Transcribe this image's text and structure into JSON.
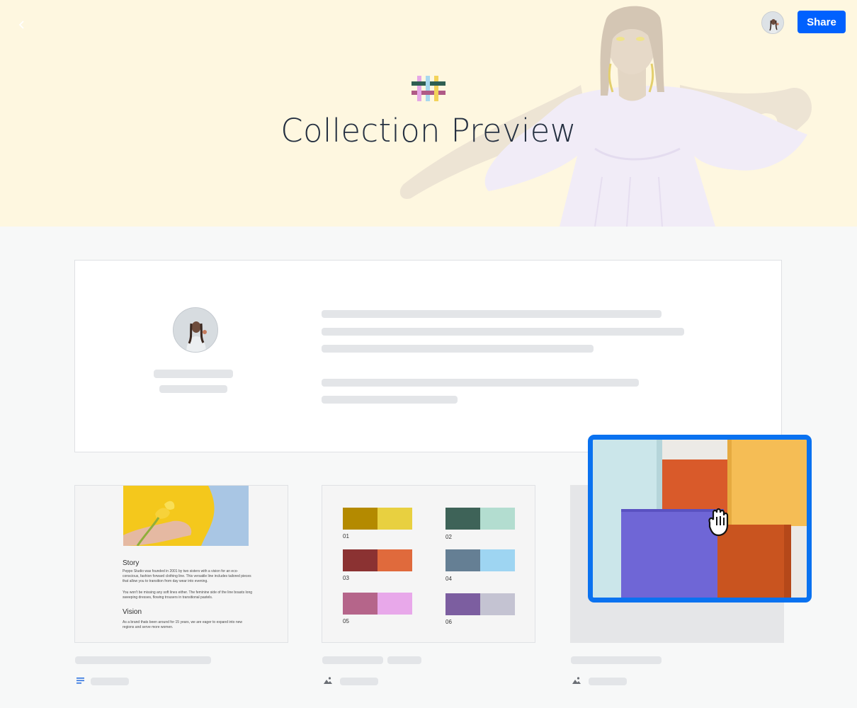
{
  "header": {
    "title": "Collection Preview",
    "share_label": "Share",
    "back_icon": "chevron-left-icon",
    "logo_icon": "woven-logo-icon"
  },
  "profile": {
    "avatar_icon": "profile-avatar"
  },
  "tiles": [
    {
      "kind": "document",
      "story_heading": "Story",
      "story_text_1": "Peppo Studio was founded in 2001 by two sisters with a vision for an eco-conscious, fashion forward clothing line. This versatile line includes tailored pieces that allow you to transition from day wear into evening.",
      "story_text_2": "You won't be missing any soft lines either. The feminine side of the line boasts long sweeping dresses, flowing trousers in transitional pastels.",
      "vision_heading": "Vision",
      "vision_text": "As a brand thats been around for 15 years, we are eager to expand into new regions and serve more women.",
      "meta_icon": "text-lines-icon"
    },
    {
      "kind": "palette",
      "swatches": [
        {
          "label": "01",
          "colors": [
            "#b48a00",
            "#e8d040"
          ]
        },
        {
          "label": "02",
          "colors": [
            "#3e6358",
            "#b3ddd0"
          ]
        },
        {
          "label": "03",
          "colors": [
            "#8b3232",
            "#e06a3c"
          ]
        },
        {
          "label": "04",
          "colors": [
            "#657f94",
            "#9ed5f2"
          ]
        },
        {
          "label": "05",
          "colors": [
            "#b5658a",
            "#e8a8ea"
          ]
        },
        {
          "label": "06",
          "colors": [
            "#7c5ea0",
            "#c4c3d2"
          ]
        }
      ],
      "meta_icon": "image-icon"
    },
    {
      "kind": "image",
      "meta_icon": "image-icon"
    }
  ],
  "drag": {
    "preview": "fabric-swatches-photo",
    "cursor_icon": "grab-hand-icon"
  },
  "colors": {
    "accent": "#0061fe",
    "hero_bg": "#fef7e0",
    "skeleton": "#e3e5e8"
  }
}
